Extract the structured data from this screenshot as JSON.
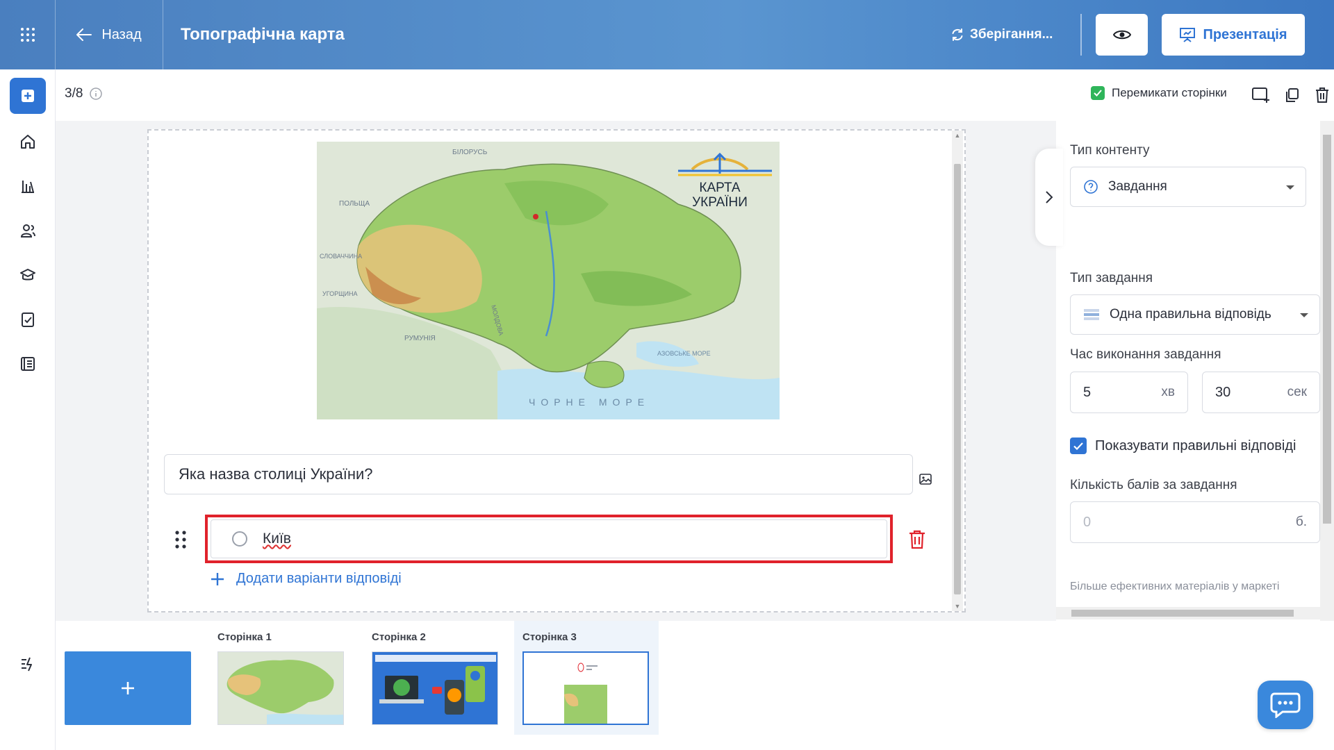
{
  "header": {
    "back_label": "Назад",
    "title": "Топографічна карта",
    "saving_label": "Зберігання...",
    "present_label": "Презентація"
  },
  "rail": {
    "items": [
      "add-icon",
      "home-icon",
      "stats-icon",
      "users-icon",
      "courses-icon",
      "tasks-icon",
      "library-icon",
      "quick-action-icon"
    ]
  },
  "toolbar": {
    "page_counter": "3/8",
    "switch_pages_label": "Перемикати сторінки",
    "switch_pages_checked": true
  },
  "slide": {
    "map": {
      "title_line1": "КАРТА",
      "title_line2": "УКРАЇНИ",
      "labels": {
        "belarus": "БІЛОРУСЬ",
        "poland": "ПОЛЬЩА",
        "slovakia": "СЛОВАЧЧИНА",
        "hungary": "УГОРЩИНА",
        "romania": "РУМУНІЯ",
        "moldova": "МОЛДОВА",
        "azov": "АЗОВСЬКЕ МОРЕ",
        "black_sea": "ЧОРНЕ   МОРЕ"
      }
    },
    "question": "Яка назва столиці України?",
    "answers": [
      {
        "text": "Київ",
        "selected": false
      }
    ],
    "add_answer_label": "Додати варіанти відповіді"
  },
  "panel": {
    "content_type_label": "Тип контенту",
    "content_type_value": "Завдання",
    "task_type_label": "Тип завдання",
    "task_type_value": "Одна правильна відповідь",
    "time_label": "Час виконання завдання",
    "time_minutes": "5",
    "time_minutes_unit": "хв",
    "time_seconds": "30",
    "time_seconds_unit": "сек",
    "show_answers_label": "Показувати правильні відповіді",
    "show_answers_checked": true,
    "points_label": "Кількість балів за завдання",
    "points_placeholder": "0",
    "points_unit": "б.",
    "footer_text": "Більше ефективних матеріалів у маркеті"
  },
  "pages": [
    {
      "label": "Сторінка 1",
      "active": false
    },
    {
      "label": "Сторінка 2",
      "active": false
    },
    {
      "label": "Сторінка 3",
      "active": true
    }
  ],
  "colors": {
    "accent": "#2f74d4",
    "highlight": "#e0222b",
    "header_start": "#4a7fbf",
    "header_end": "#3c78c2",
    "success": "#2fb55a"
  }
}
